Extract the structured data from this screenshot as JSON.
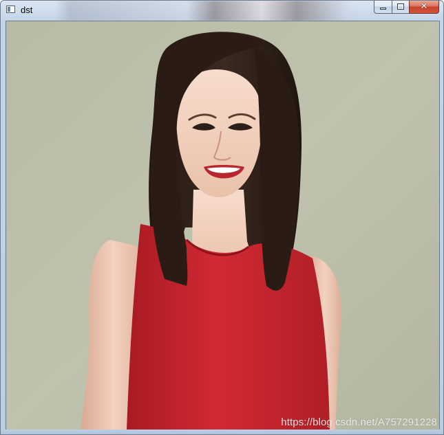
{
  "window": {
    "title": "dst",
    "icon": "app-window-icon",
    "caption_buttons": [
      {
        "name": "minimize",
        "icon": "minimize-icon"
      },
      {
        "name": "maximize",
        "icon": "maximize-icon"
      },
      {
        "name": "close",
        "icon": "close-icon",
        "glyph": "✕"
      }
    ]
  },
  "image": {
    "watermark": "https://blog.csdn.net/A757291228"
  },
  "colors": {
    "background": "#b9bca7",
    "dress": "#c8242c",
    "hair": "#2b1e18",
    "skin": "#f0cdb8",
    "close_button": "#c5432b"
  }
}
